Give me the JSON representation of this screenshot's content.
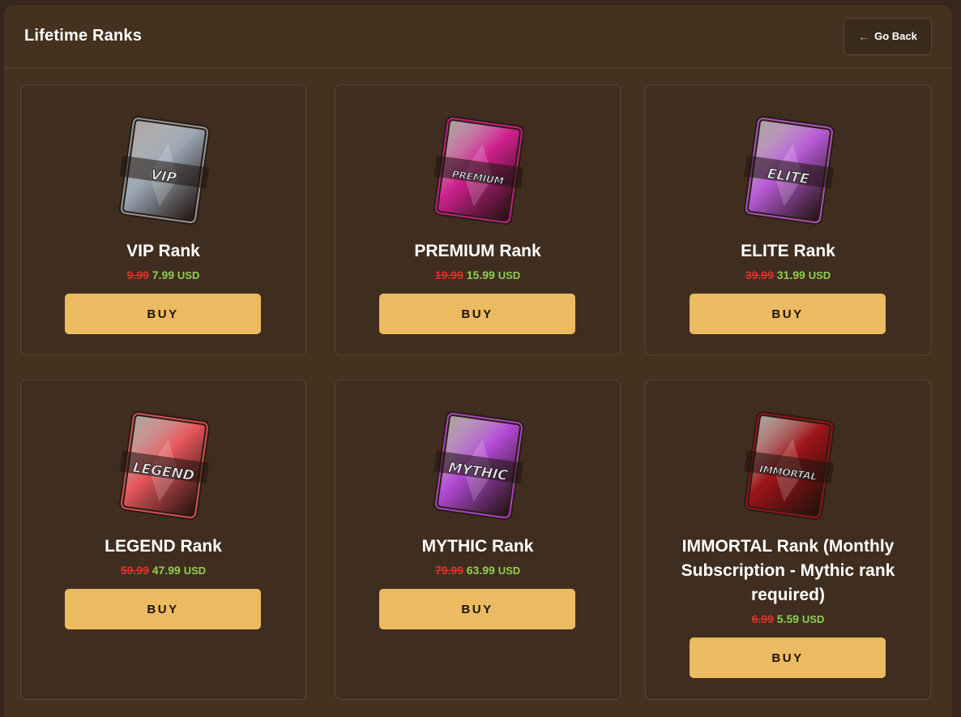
{
  "header": {
    "title": "Lifetime Ranks",
    "back_label": "Go Back"
  },
  "colors": {
    "accent": "#ecba60",
    "old_price": "#e0332b",
    "new_price": "#8fcf4e",
    "panel": "#44311f"
  },
  "ranks": [
    {
      "name": "VIP Rank",
      "old_price": "9.99",
      "new_price": "7.99",
      "currency": "USD",
      "buy_label": "BUY",
      "icon": "vip-rank-icon",
      "color": "#9aa6b4",
      "banner": "VIP"
    },
    {
      "name": "PREMIUM Rank",
      "old_price": "19.99",
      "new_price": "15.99",
      "currency": "USD",
      "buy_label": "BUY",
      "icon": "premium-rank-icon",
      "color": "#d0208f",
      "banner": "PREMIUM"
    },
    {
      "name": "ELITE Rank",
      "old_price": "39.99",
      "new_price": "31.99",
      "currency": "USD",
      "buy_label": "BUY",
      "icon": "elite-rank-icon",
      "color": "#b85bd8",
      "banner": "ELITE"
    },
    {
      "name": "LEGEND Rank",
      "old_price": "59.99",
      "new_price": "47.99",
      "currency": "USD",
      "buy_label": "BUY",
      "icon": "legend-rank-icon",
      "color": "#e6565b",
      "banner": "LEGEND"
    },
    {
      "name": "MYTHIC Rank",
      "old_price": "79.99",
      "new_price": "63.99",
      "currency": "USD",
      "buy_label": "BUY",
      "icon": "mythic-rank-icon",
      "color": "#b34ad6",
      "banner": "MYTHIC"
    },
    {
      "name": "IMMORTAL Rank (Monthly Subscription - Mythic rank required)",
      "old_price": "6.99",
      "new_price": "5.59",
      "currency": "USD",
      "buy_label": "BUY",
      "icon": "immortal-rank-icon",
      "color": "#9e1418",
      "banner": "IMMORTAL"
    }
  ]
}
